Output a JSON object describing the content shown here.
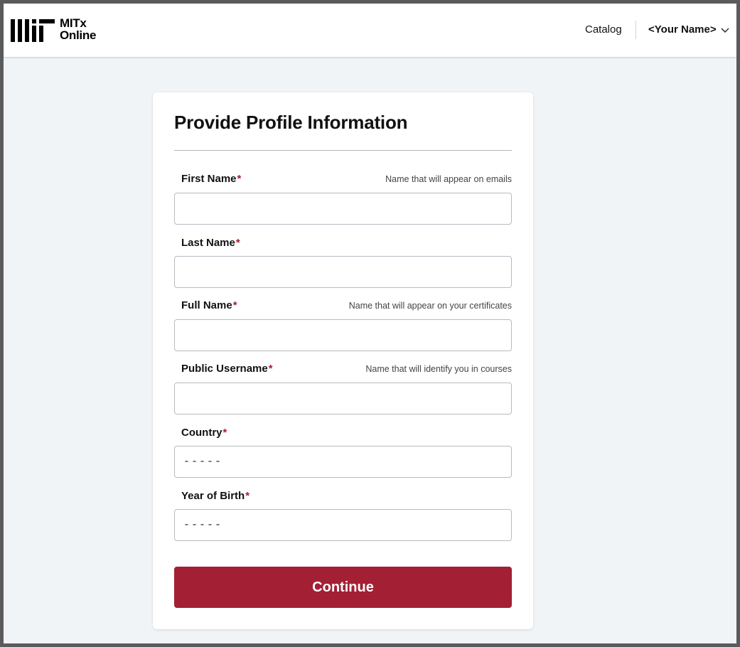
{
  "header": {
    "logo_text_line1": "MITx",
    "logo_text_line2": "Online",
    "nav_catalog": "Catalog",
    "user_name": "<Your Name>"
  },
  "form": {
    "title": "Provide Profile Information",
    "required_mark": "*",
    "fields": [
      {
        "label": "First Name",
        "hint": "Name that will appear on emails",
        "value": ""
      },
      {
        "label": "Last Name",
        "hint": "",
        "value": ""
      },
      {
        "label": "Full Name",
        "hint": "Name that will appear on your certificates",
        "value": ""
      },
      {
        "label": "Public Username",
        "hint": "Name that will identify you in courses",
        "value": ""
      },
      {
        "label": "Country",
        "hint": "",
        "selected": "-----"
      },
      {
        "label": "Year of Birth",
        "hint": "",
        "selected": "-----"
      }
    ],
    "submit_label": "Continue"
  },
  "colors": {
    "accent": "#a31f34",
    "page_background": "#f0f4f6",
    "card_background": "#ffffff"
  },
  "icons": {
    "logo": "mit-logo-icon",
    "user_menu": "chevron-down-icon"
  }
}
